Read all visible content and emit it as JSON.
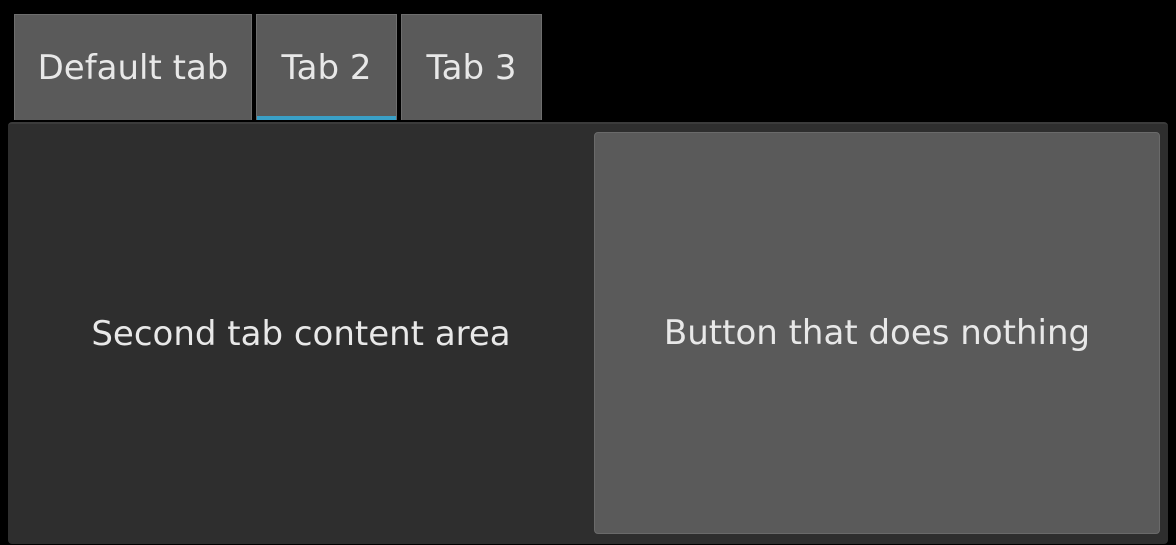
{
  "tabs": [
    {
      "label": "Default tab",
      "selected": false
    },
    {
      "label": "Tab 2",
      "selected": true
    },
    {
      "label": "Tab 3",
      "selected": false
    }
  ],
  "content": {
    "text": "Second tab content area",
    "button_label": "Button that does nothing"
  },
  "colors": {
    "background": "#000000",
    "tab": "#5a5a5a",
    "panel": "#2e2e2e",
    "button": "#5a5a5a",
    "selected_indicator": "#3aa0c7",
    "text": "#e8e8e8"
  }
}
